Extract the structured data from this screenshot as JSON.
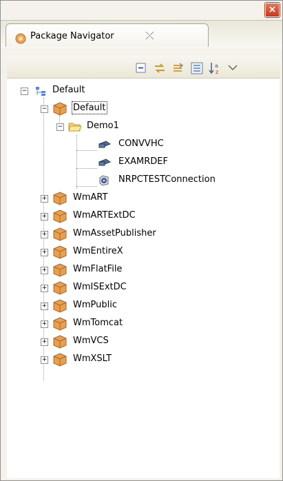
{
  "window": {
    "close_label": "×"
  },
  "tab": {
    "title": "Package Navigator",
    "close_glyph": "⤫"
  },
  "toolbar": {
    "buttons": [
      "collapse-all-icon",
      "link-with-editor-icon",
      "sync-icon",
      "filter-icon",
      "sort-icon",
      "view-menu-icon"
    ]
  },
  "tree": {
    "root": {
      "label": "Default",
      "expanded": true
    },
    "server": {
      "label": "Default",
      "expanded": true
    },
    "folder": {
      "label": "Demo1",
      "expanded": true
    },
    "children": [
      {
        "label": "CONVVHC"
      },
      {
        "label": "EXAMRDEF"
      },
      {
        "label": "NRPCTESTConnection"
      }
    ],
    "packages": [
      {
        "label": "WmART"
      },
      {
        "label": "WmARTExtDC"
      },
      {
        "label": "WmAssetPublisher"
      },
      {
        "label": "WmEntireX"
      },
      {
        "label": "WmFlatFile"
      },
      {
        "label": "WmISExtDC"
      },
      {
        "label": "WmPublic"
      },
      {
        "label": "WmTomcat"
      },
      {
        "label": "WmVCS"
      },
      {
        "label": "WmXSLT"
      }
    ]
  }
}
